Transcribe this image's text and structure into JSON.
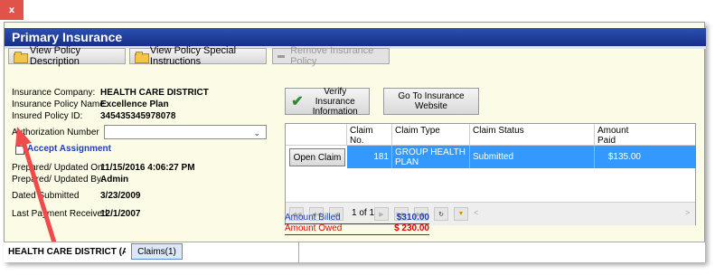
{
  "window": {
    "close_label": "x",
    "title": "Primary Insurance"
  },
  "toolbar": {
    "view_desc_label": "View Policy Description",
    "view_instructions_label": "View Policy Special Instructions",
    "remove_label": "Remove Insurance Policy"
  },
  "policy": {
    "company_label": "Insurance Company:",
    "company_value": "HEALTH CARE DISTRICT",
    "policy_name_label": "Insurance Policy Name:",
    "policy_name_value": "Excellence Plan",
    "insured_id_label": "Insured Policy ID:",
    "insured_id_value": "345435345978078",
    "auth_label": "Authorization Number",
    "auth_value": "",
    "accept_label": "Accept Assignment",
    "accept_checked": false,
    "updated_on_label": "Prepared/ Updated  On:",
    "updated_on_value": "11/15/2016 4:06:27 PM",
    "updated_by_label": "Prepared/ Updated  By:",
    "updated_by_value": "Admin",
    "dated_submitted_label": "Dated Submitted",
    "dated_submitted_value": "3/23/2009",
    "last_payment_label": "Last Payment Received",
    "last_payment_value": "12/1/2007"
  },
  "actions": {
    "verify_label": "Verify Insurance Information",
    "website_label": "Go To Insurance Website"
  },
  "claims_grid": {
    "headers": [
      "Claim No.",
      "Claim Type",
      "Claim Status",
      "Amount Paid"
    ],
    "open_claim_label": "Open Claim",
    "rows": [
      {
        "claim_no": "181",
        "claim_type": "GROUP HEALTH PLAN",
        "claim_status": "Submitted",
        "amount_paid": "$135.00"
      }
    ],
    "pager_text": "1 of 1"
  },
  "amounts": {
    "billed_label": "Amount Billed",
    "billed_value": "$310.00",
    "owed_label": "Amount Owed",
    "owed_value": "$ 230.00"
  },
  "bottom": {
    "tab_label": "HEALTH CARE DISTRICT (Acce",
    "claims_tab_label": "Claims(1)"
  },
  "colors": {
    "title_bar": "#1f3d9e",
    "panel_bg": "#fcfce6",
    "selected_row": "#3399ff",
    "billed": "#1f3fb8",
    "owed": "#e00000",
    "annotation_arrow": "#f04a4a"
  },
  "icons": [
    "close-icon",
    "folder-icon",
    "minus-icon",
    "checkmark-icon",
    "chevron-down-icon",
    "pager-first-icon",
    "pager-prev-icon",
    "pager-next-icon",
    "pager-last-icon",
    "refresh-icon",
    "filter-icon"
  ]
}
